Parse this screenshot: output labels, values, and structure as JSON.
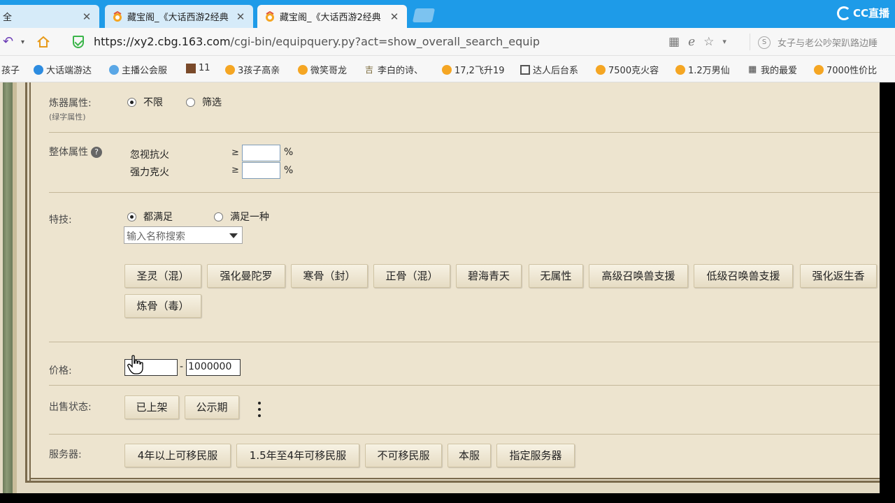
{
  "tabs": [
    {
      "title": "全",
      "active": false
    },
    {
      "title": "藏宝阁_《大话西游2经典",
      "active": false
    },
    {
      "title": "藏宝阁_《大话西游2经典",
      "active": true
    }
  ],
  "stream_logo": "CC直播",
  "address": {
    "url_host": "https://xy2.cbg.163.com",
    "url_path": "/cgi-bin/equipquery.py?act=show_overall_search_equip",
    "search_text": "女子与老公吵架趴路边睡"
  },
  "bookmarks": [
    "孩子",
    "大话端游达",
    "主播公会服",
    "11",
    "3孩子高亲",
    "微笑哥龙",
    "李白的诗、",
    "17,2飞升19",
    "达人后台系",
    "7500克火容",
    "1.2万男仙",
    "我的最爱",
    "7000性价比"
  ],
  "refining": {
    "label": "炼器属性:",
    "sublabel": "(绿字属性)",
    "options": [
      "不限",
      "筛选"
    ],
    "selected": "不限"
  },
  "overall": {
    "label": "整体属性",
    "help": "?",
    "ge": "≥",
    "unit": "%",
    "rows": [
      "忽视抗火",
      "强力克火"
    ]
  },
  "skills": {
    "label": "特技:",
    "options": [
      "都满足",
      "满足一种"
    ],
    "selected": "都满足",
    "search_placeholder": "输入名称搜索",
    "tags": [
      "圣灵（混）",
      "强化曼陀罗",
      "寒骨（封）",
      "正骨（混）",
      "碧海青天",
      "无属性",
      "高级召唤兽支援",
      "低级召唤兽支援",
      "强化返生香",
      "炼骨（毒）"
    ]
  },
  "price": {
    "label": "价格:",
    "min": "",
    "separator": "-",
    "max": "1000000"
  },
  "sale_status": {
    "label": "出售状态:",
    "buttons": [
      "已上架",
      "公示期"
    ]
  },
  "server": {
    "label": "服务器:",
    "buttons": [
      "4年以上可移民服",
      "1.5年至4年可移民服",
      "不可移民服",
      "本服",
      "指定服务器"
    ]
  },
  "icons": {
    "back": "back-icon",
    "home": "home-icon",
    "shield": "shield-icon",
    "qr": "qr-icon",
    "ie": "ie-icon",
    "star": "star-icon",
    "cursor": "hand-cursor-icon"
  },
  "colors": {
    "tabstrip": "#1e9be8",
    "page_bg": "#ede4cf",
    "accent": "#3bb54a"
  }
}
